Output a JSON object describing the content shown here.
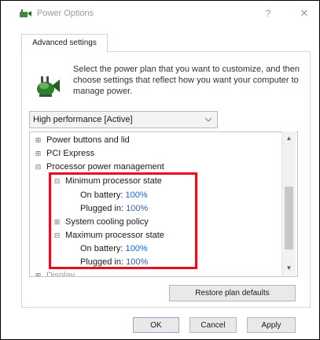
{
  "window": {
    "title": "Power Options",
    "help_glyph": "?",
    "close_glyph": "✕",
    "icon": "power-options-icon"
  },
  "tabs": [
    {
      "label": "Advanced settings"
    }
  ],
  "description": "Select the power plan that you want to customize, and then choose settings that reflect how you want your computer to manage power.",
  "plan_select": {
    "value": "High performance [Active]"
  },
  "tree": {
    "items": [
      {
        "expander": "⊞",
        "label": "Power buttons and lid"
      },
      {
        "expander": "⊞",
        "label": "PCI Express"
      },
      {
        "expander": "⊟",
        "label": "Processor power management"
      },
      {
        "expander": "⊟",
        "label": "Minimum processor state"
      },
      {
        "label": "On battery:",
        "value": "100%"
      },
      {
        "label": "Plugged in:",
        "value": "100%"
      },
      {
        "expander": "⊞",
        "label": "System cooling policy"
      },
      {
        "expander": "⊟",
        "label": "Maximum processor state"
      },
      {
        "label": "On battery:",
        "value": "100%"
      },
      {
        "label": "Plugged in:",
        "value": "100%"
      },
      {
        "expander": "⊞",
        "label": "Display"
      }
    ]
  },
  "scrollbar": {
    "up_glyph": "▲",
    "down_glyph": "▼"
  },
  "buttons": {
    "restore": "Restore plan defaults",
    "ok": "OK",
    "cancel": "Cancel",
    "apply": "Apply"
  },
  "colors": {
    "highlight": "#e5101f",
    "value_link": "#1c64d4"
  }
}
